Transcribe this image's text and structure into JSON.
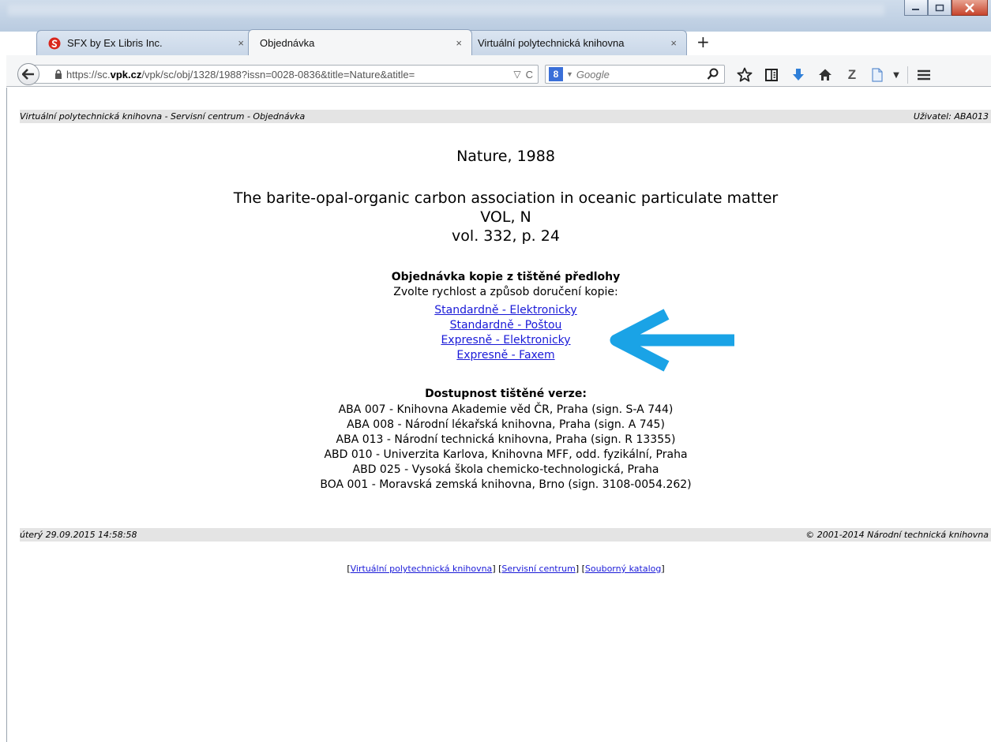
{
  "browser": {
    "tabs": [
      {
        "title": "SFX by Ex Libris Inc.",
        "close": "×"
      },
      {
        "title": "Objednávka",
        "close": "×"
      },
      {
        "title": "Virtuální polytechnická knihovna",
        "close": "×"
      }
    ],
    "new_tab": "+",
    "url": {
      "prefix": "https://sc.",
      "host": "vpk.cz",
      "rest": "/vpk/sc/obj/1328/1988?issn=0028-0836&title=Nature&atitle="
    },
    "search": {
      "engine_badge": "8",
      "placeholder": "Google"
    },
    "icons": [
      "back-icon",
      "lock-icon",
      "dropdown-icon",
      "reload-icon",
      "google-icon",
      "search-icon",
      "star-icon",
      "reading-list-icon",
      "download-icon",
      "home-icon",
      "zotero-icon",
      "document-icon",
      "menu-icon"
    ]
  },
  "page": {
    "header_left": "Virtuální polytechnická knihovna - Servisní centrum - Objednávka",
    "header_right": "Uživatel: ABA013",
    "journal": "Nature, 1988",
    "article_title": "The barite-opal-organic carbon association in oceanic particulate matter",
    "article_vol_label": "VOL, N",
    "article_issue": "vol. 332, p. 24",
    "order_heading": "Objednávka kopie z tištěné předlohy",
    "order_sub": "Zvolte rychlost a způsob doručení kopie:",
    "order_links": [
      "Standardně - Elektronicky",
      "Standardně - Poštou",
      "Expresně - Elektronicky",
      "Expresně - Faxem"
    ],
    "availability_heading": "Dostupnost tištěné verze:",
    "availability": [
      "ABA 007 - Knihovna Akademie věd ČR, Praha (sign. S-A 744)",
      "ABA 008 - Národní lékařská knihovna, Praha (sign. A 745)",
      "ABA 013 - Národní technická knihovna, Praha (sign. R 13355)",
      "ABD 010 - Univerzita Karlova, Knihovna MFF, odd. fyzikální, Praha",
      "ABD 025 - Vysoká škola chemicko-technologická, Praha",
      "BOA 001 - Moravská zemská knihovna, Brno (sign. 3108-0054.262)"
    ],
    "footer_left": "úterý 29.09.2015 14:58:58",
    "footer_right": "© 2001-2014 Národní technická knihovna",
    "footer_links": [
      "Virtuální polytechnická knihovna",
      "Servisní centrum",
      "Souborný katalog"
    ],
    "colors": {
      "link": "#1a1ad8",
      "bar": "#e4e4e4",
      "arrow": "#1aa3e6"
    }
  }
}
